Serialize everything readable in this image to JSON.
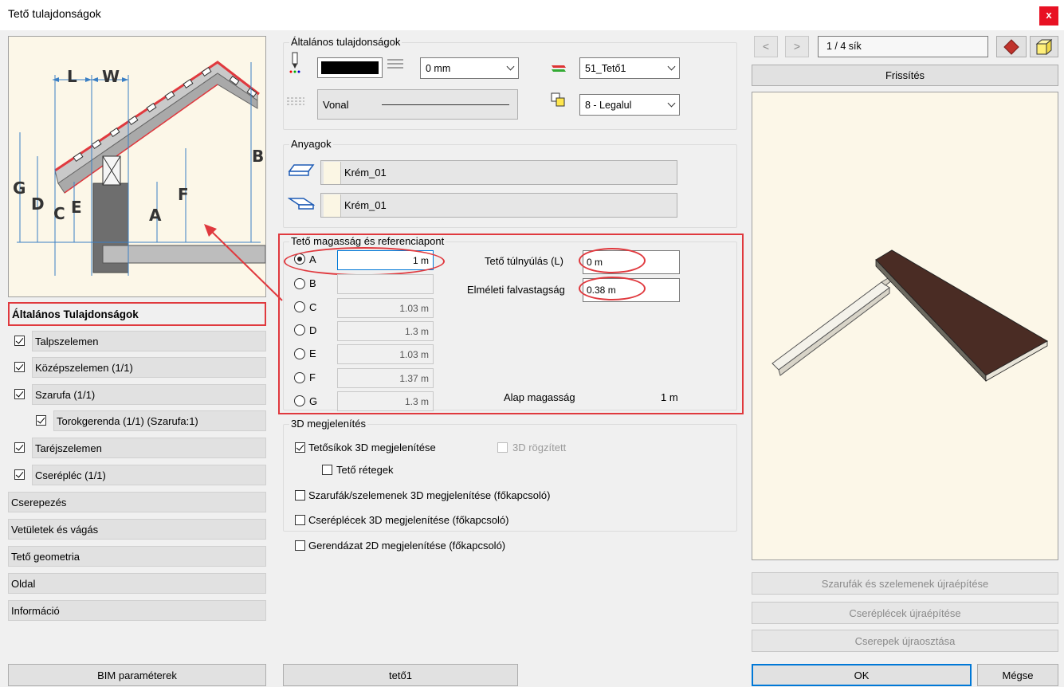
{
  "window": {
    "title": "Tető tulajdonságok",
    "close_label": "x"
  },
  "diagram_labels": {
    "L": "L",
    "W": "W",
    "B": "B",
    "G": "G",
    "D": "D",
    "C": "C",
    "E": "E",
    "A": "A",
    "F": "F"
  },
  "nav": {
    "active": "Általános Tulajdonságok",
    "checked_items": [
      {
        "label": "Talpszelemen",
        "checked": true
      },
      {
        "label": "Középszelemen (1/1)",
        "checked": true
      },
      {
        "label": "Szarufa (1/1)",
        "checked": true
      },
      {
        "label": "Torokgerenda (1/1) (Szarufa:1)",
        "checked": true
      },
      {
        "label": "Taréjszelemen",
        "checked": true
      },
      {
        "label": "Cserépléc (1/1)",
        "checked": true
      }
    ],
    "plain_items": [
      "Cserepezés",
      "Vetületek és vágás",
      "Tető geometria",
      "Oldal",
      "Információ"
    ]
  },
  "general": {
    "title": "Általános tulajdonságok",
    "thickness_value": "0 mm",
    "layer_value": "51_Tető1",
    "line_type_label": "Vonal",
    "draw_order_value": "8 - Legalul"
  },
  "materials": {
    "title": "Anyagok",
    "top": "Krém_01",
    "bottom": "Krém_01"
  },
  "height_ref": {
    "title": "Tető magasság és referenciapont",
    "selected": "A",
    "options": [
      {
        "key": "A",
        "value": "1 m"
      },
      {
        "key": "B",
        "value": ""
      },
      {
        "key": "C",
        "value": "1.03 m"
      },
      {
        "key": "D",
        "value": "1.3 m"
      },
      {
        "key": "E",
        "value": "1.03 m"
      },
      {
        "key": "F",
        "value": "1.37 m"
      },
      {
        "key": "G",
        "value": "1.3 m"
      }
    ],
    "overhang_label": "Tető túlnyúlás (L)",
    "overhang_value": "0 m",
    "wall_thickness_label": "Elméleti falvastagság",
    "wall_thickness_value": "0.38 m",
    "base_height_label": "Alap magasság",
    "base_height_value": "1 m"
  },
  "display3d": {
    "title": "3D megjelenítés",
    "roof_planes_3d": "Tetősíkok 3D megjelenítése",
    "fixed_3d": "3D rögzített",
    "roof_layers": "Tető rétegek",
    "rafters_3d": "Szarufák/szelemenek 3D megjelenítése (főkapcsoló)",
    "battens_3d": "Cseréplécek 3D megjelenítése (főkapcsoló)",
    "beams_2d": "Gerendázat 2D megjelenítése (főkapcsoló)"
  },
  "preview": {
    "prev": "<",
    "next": ">",
    "plane_counter": "1 / 4 sík",
    "refresh": "Frissítés",
    "roof_color": "#4a2c24",
    "bg_color": "#fcf7e8"
  },
  "rebuild": {
    "rafters": "Szarufák és szelemenek újraépítése",
    "battens": "Cseréplécek újraépítése",
    "tiles": "Cserepek újraosztása"
  },
  "footer": {
    "bim": "BIM paraméterek",
    "name": "tető1",
    "ok": "OK",
    "cancel": "Mégse"
  }
}
